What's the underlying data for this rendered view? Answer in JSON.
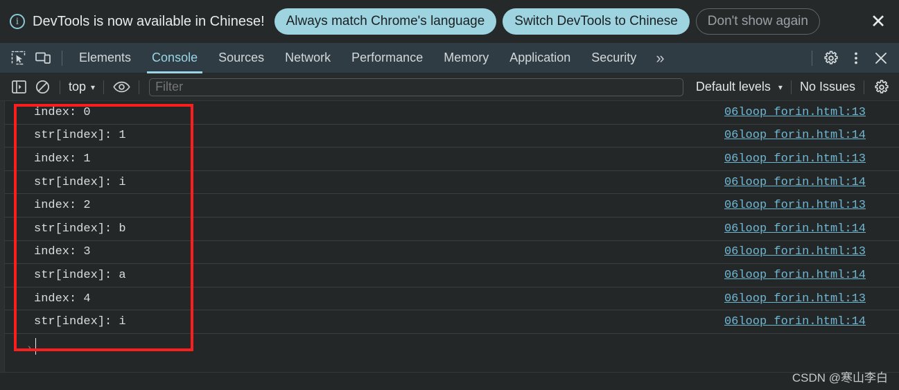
{
  "banner": {
    "info_icon": "info-circle-icon",
    "message": "DevTools is now available in Chinese!",
    "buttons": [
      {
        "label": "Always match Chrome's language",
        "style": "primary"
      },
      {
        "label": "Switch DevTools to Chinese",
        "style": "primary"
      },
      {
        "label": "Don't show again",
        "style": "ghost"
      }
    ],
    "close_icon": "close-icon",
    "bg": "#26292a",
    "accent": "#9ed3e0"
  },
  "tabbar": {
    "left_icons": [
      "inspect-element-icon",
      "device-toolbar-icon"
    ],
    "tabs": [
      {
        "label": "Elements",
        "active": false
      },
      {
        "label": "Console",
        "active": true
      },
      {
        "label": "Sources",
        "active": false
      },
      {
        "label": "Network",
        "active": false
      },
      {
        "label": "Performance",
        "active": false
      },
      {
        "label": "Memory",
        "active": false
      },
      {
        "label": "Application",
        "active": false
      },
      {
        "label": "Security",
        "active": false
      }
    ],
    "more_label": "»",
    "right_icons": [
      "gear-icon",
      "kebab-menu-icon",
      "close-icon"
    ],
    "active_color": "#9ad6e8",
    "bg": "#2f3c43"
  },
  "console_toolbar": {
    "sidebar_toggle_icon": "sidebar-toggle-icon",
    "clear_icon": "clear-console-icon",
    "context_label": "top",
    "context_caret": "▾",
    "eye_icon": "live-expression-eye-icon",
    "filter_placeholder": "Filter",
    "filter_value": "",
    "levels_label": "Default levels",
    "levels_caret": "▾",
    "issues_label": "No Issues",
    "settings_icon": "gear-icon"
  },
  "console": {
    "source_file": "06loop_forin.html",
    "rows": [
      {
        "text": "index: 0",
        "link": "06loop_forin.html:13"
      },
      {
        "text": "str[index]: 1",
        "link": "06loop_forin.html:14"
      },
      {
        "text": "index: 1",
        "link": "06loop_forin.html:13"
      },
      {
        "text": "str[index]: i",
        "link": "06loop_forin.html:14"
      },
      {
        "text": "index: 2",
        "link": "06loop_forin.html:13"
      },
      {
        "text": "str[index]: b",
        "link": "06loop_forin.html:14"
      },
      {
        "text": "index: 3",
        "link": "06loop_forin.html:13"
      },
      {
        "text": "str[index]: a",
        "link": "06loop_forin.html:14"
      },
      {
        "text": "index: 4",
        "link": "06loop_forin.html:13"
      },
      {
        "text": "str[index]: i",
        "link": "06loop_forin.html:14"
      }
    ],
    "prompt_caret": "›",
    "prompt_value": "",
    "link_color": "#6fb8d4",
    "text_color": "#d9dde0"
  },
  "annotation": {
    "color": "#fa1e1e"
  },
  "watermark": {
    "text": "CSDN @寒山李白"
  }
}
